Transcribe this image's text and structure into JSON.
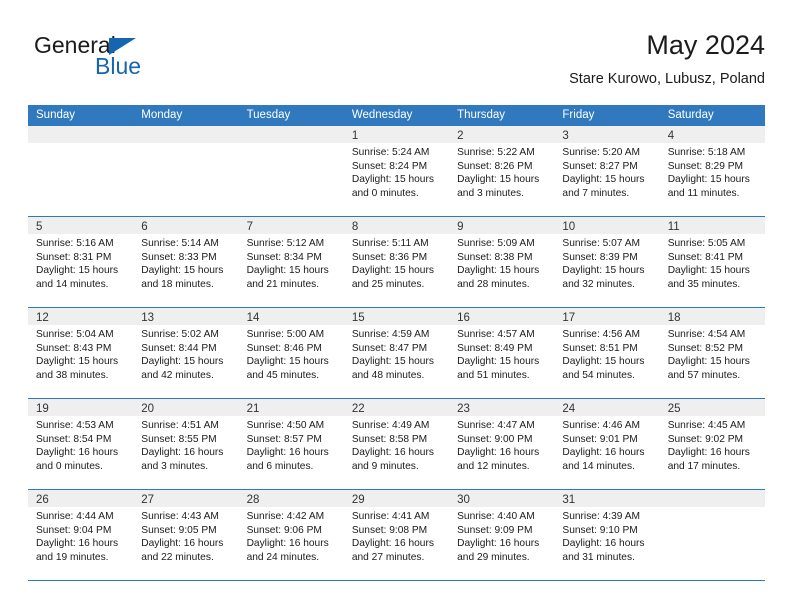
{
  "brand": {
    "name_top": "General",
    "name_bottom": "Blue",
    "accent_color": "#1565b0",
    "triangle_icon": "triangle-icon"
  },
  "header": {
    "title": "May 2024",
    "subtitle": "Stare Kurowo, Lubusz, Poland"
  },
  "calendar": {
    "header_bg": "#3079be",
    "daynum_bg": "#efefef",
    "weekday_headers": [
      "Sunday",
      "Monday",
      "Tuesday",
      "Wednesday",
      "Thursday",
      "Friday",
      "Saturday"
    ],
    "weeks": [
      [
        {
          "day": "",
          "sunrise": "",
          "sunset": "",
          "daylight_1": "",
          "daylight_2": ""
        },
        {
          "day": "",
          "sunrise": "",
          "sunset": "",
          "daylight_1": "",
          "daylight_2": ""
        },
        {
          "day": "",
          "sunrise": "",
          "sunset": "",
          "daylight_1": "",
          "daylight_2": ""
        },
        {
          "day": "1",
          "sunrise": "Sunrise: 5:24 AM",
          "sunset": "Sunset: 8:24 PM",
          "daylight_1": "Daylight: 15 hours",
          "daylight_2": "and 0 minutes."
        },
        {
          "day": "2",
          "sunrise": "Sunrise: 5:22 AM",
          "sunset": "Sunset: 8:26 PM",
          "daylight_1": "Daylight: 15 hours",
          "daylight_2": "and 3 minutes."
        },
        {
          "day": "3",
          "sunrise": "Sunrise: 5:20 AM",
          "sunset": "Sunset: 8:27 PM",
          "daylight_1": "Daylight: 15 hours",
          "daylight_2": "and 7 minutes."
        },
        {
          "day": "4",
          "sunrise": "Sunrise: 5:18 AM",
          "sunset": "Sunset: 8:29 PM",
          "daylight_1": "Daylight: 15 hours",
          "daylight_2": "and 11 minutes."
        }
      ],
      [
        {
          "day": "5",
          "sunrise": "Sunrise: 5:16 AM",
          "sunset": "Sunset: 8:31 PM",
          "daylight_1": "Daylight: 15 hours",
          "daylight_2": "and 14 minutes."
        },
        {
          "day": "6",
          "sunrise": "Sunrise: 5:14 AM",
          "sunset": "Sunset: 8:33 PM",
          "daylight_1": "Daylight: 15 hours",
          "daylight_2": "and 18 minutes."
        },
        {
          "day": "7",
          "sunrise": "Sunrise: 5:12 AM",
          "sunset": "Sunset: 8:34 PM",
          "daylight_1": "Daylight: 15 hours",
          "daylight_2": "and 21 minutes."
        },
        {
          "day": "8",
          "sunrise": "Sunrise: 5:11 AM",
          "sunset": "Sunset: 8:36 PM",
          "daylight_1": "Daylight: 15 hours",
          "daylight_2": "and 25 minutes."
        },
        {
          "day": "9",
          "sunrise": "Sunrise: 5:09 AM",
          "sunset": "Sunset: 8:38 PM",
          "daylight_1": "Daylight: 15 hours",
          "daylight_2": "and 28 minutes."
        },
        {
          "day": "10",
          "sunrise": "Sunrise: 5:07 AM",
          "sunset": "Sunset: 8:39 PM",
          "daylight_1": "Daylight: 15 hours",
          "daylight_2": "and 32 minutes."
        },
        {
          "day": "11",
          "sunrise": "Sunrise: 5:05 AM",
          "sunset": "Sunset: 8:41 PM",
          "daylight_1": "Daylight: 15 hours",
          "daylight_2": "and 35 minutes."
        }
      ],
      [
        {
          "day": "12",
          "sunrise": "Sunrise: 5:04 AM",
          "sunset": "Sunset: 8:43 PM",
          "daylight_1": "Daylight: 15 hours",
          "daylight_2": "and 38 minutes."
        },
        {
          "day": "13",
          "sunrise": "Sunrise: 5:02 AM",
          "sunset": "Sunset: 8:44 PM",
          "daylight_1": "Daylight: 15 hours",
          "daylight_2": "and 42 minutes."
        },
        {
          "day": "14",
          "sunrise": "Sunrise: 5:00 AM",
          "sunset": "Sunset: 8:46 PM",
          "daylight_1": "Daylight: 15 hours",
          "daylight_2": "and 45 minutes."
        },
        {
          "day": "15",
          "sunrise": "Sunrise: 4:59 AM",
          "sunset": "Sunset: 8:47 PM",
          "daylight_1": "Daylight: 15 hours",
          "daylight_2": "and 48 minutes."
        },
        {
          "day": "16",
          "sunrise": "Sunrise: 4:57 AM",
          "sunset": "Sunset: 8:49 PM",
          "daylight_1": "Daylight: 15 hours",
          "daylight_2": "and 51 minutes."
        },
        {
          "day": "17",
          "sunrise": "Sunrise: 4:56 AM",
          "sunset": "Sunset: 8:51 PM",
          "daylight_1": "Daylight: 15 hours",
          "daylight_2": "and 54 minutes."
        },
        {
          "day": "18",
          "sunrise": "Sunrise: 4:54 AM",
          "sunset": "Sunset: 8:52 PM",
          "daylight_1": "Daylight: 15 hours",
          "daylight_2": "and 57 minutes."
        }
      ],
      [
        {
          "day": "19",
          "sunrise": "Sunrise: 4:53 AM",
          "sunset": "Sunset: 8:54 PM",
          "daylight_1": "Daylight: 16 hours",
          "daylight_2": "and 0 minutes."
        },
        {
          "day": "20",
          "sunrise": "Sunrise: 4:51 AM",
          "sunset": "Sunset: 8:55 PM",
          "daylight_1": "Daylight: 16 hours",
          "daylight_2": "and 3 minutes."
        },
        {
          "day": "21",
          "sunrise": "Sunrise: 4:50 AM",
          "sunset": "Sunset: 8:57 PM",
          "daylight_1": "Daylight: 16 hours",
          "daylight_2": "and 6 minutes."
        },
        {
          "day": "22",
          "sunrise": "Sunrise: 4:49 AM",
          "sunset": "Sunset: 8:58 PM",
          "daylight_1": "Daylight: 16 hours",
          "daylight_2": "and 9 minutes."
        },
        {
          "day": "23",
          "sunrise": "Sunrise: 4:47 AM",
          "sunset": "Sunset: 9:00 PM",
          "daylight_1": "Daylight: 16 hours",
          "daylight_2": "and 12 minutes."
        },
        {
          "day": "24",
          "sunrise": "Sunrise: 4:46 AM",
          "sunset": "Sunset: 9:01 PM",
          "daylight_1": "Daylight: 16 hours",
          "daylight_2": "and 14 minutes."
        },
        {
          "day": "25",
          "sunrise": "Sunrise: 4:45 AM",
          "sunset": "Sunset: 9:02 PM",
          "daylight_1": "Daylight: 16 hours",
          "daylight_2": "and 17 minutes."
        }
      ],
      [
        {
          "day": "26",
          "sunrise": "Sunrise: 4:44 AM",
          "sunset": "Sunset: 9:04 PM",
          "daylight_1": "Daylight: 16 hours",
          "daylight_2": "and 19 minutes."
        },
        {
          "day": "27",
          "sunrise": "Sunrise: 4:43 AM",
          "sunset": "Sunset: 9:05 PM",
          "daylight_1": "Daylight: 16 hours",
          "daylight_2": "and 22 minutes."
        },
        {
          "day": "28",
          "sunrise": "Sunrise: 4:42 AM",
          "sunset": "Sunset: 9:06 PM",
          "daylight_1": "Daylight: 16 hours",
          "daylight_2": "and 24 minutes."
        },
        {
          "day": "29",
          "sunrise": "Sunrise: 4:41 AM",
          "sunset": "Sunset: 9:08 PM",
          "daylight_1": "Daylight: 16 hours",
          "daylight_2": "and 27 minutes."
        },
        {
          "day": "30",
          "sunrise": "Sunrise: 4:40 AM",
          "sunset": "Sunset: 9:09 PM",
          "daylight_1": "Daylight: 16 hours",
          "daylight_2": "and 29 minutes."
        },
        {
          "day": "31",
          "sunrise": "Sunrise: 4:39 AM",
          "sunset": "Sunset: 9:10 PM",
          "daylight_1": "Daylight: 16 hours",
          "daylight_2": "and 31 minutes."
        },
        {
          "day": "",
          "sunrise": "",
          "sunset": "",
          "daylight_1": "",
          "daylight_2": ""
        }
      ]
    ]
  }
}
